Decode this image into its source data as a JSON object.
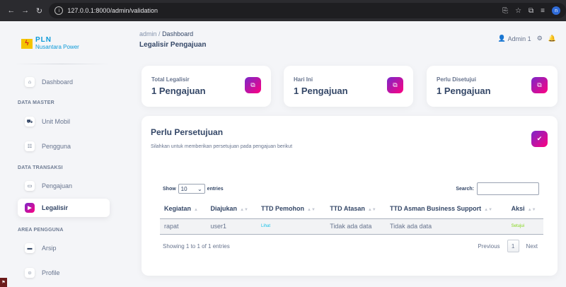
{
  "browser": {
    "url": "127.0.0.1:8000/admin/validation",
    "profile_initial": "n"
  },
  "sidebar": {
    "logo_title": "PLN",
    "logo_subtitle": "Nusantara Power",
    "items": [
      {
        "label": "Dashboard",
        "icon": "home-icon"
      },
      {
        "label": "Unit Mobil",
        "icon": "car-icon"
      },
      {
        "label": "Pengguna",
        "icon": "users-icon"
      },
      {
        "label": "Pengajuan",
        "icon": "document-icon"
      },
      {
        "label": "Legalisir",
        "icon": "stamp-icon",
        "active": true
      },
      {
        "label": "Arsip",
        "icon": "folder-icon"
      },
      {
        "label": "Profile",
        "icon": "profile-icon"
      }
    ],
    "sections": [
      "DATA MASTER",
      "DATA TRANSAKSI",
      "AREA PENGGUNA"
    ]
  },
  "header": {
    "breadcrumb_root": "admin",
    "breadcrumb_sep": "/",
    "breadcrumb_current": "Dashboard",
    "title": "Legalisir Pengajuan",
    "user_name": "Admin 1"
  },
  "stats": [
    {
      "label": "Total Legalisir",
      "value": "1 Pengajuan"
    },
    {
      "label": "Hari Ini",
      "value": "1 Pengajuan"
    },
    {
      "label": "Perlu Disetujui",
      "value": "1 Pengajuan"
    }
  ],
  "approval": {
    "title": "Perlu Persetujuan",
    "subtitle": "Silahkan untuk memberikan persetujuan pada pengajuan berikut",
    "show_label": "Show",
    "show_value": "10",
    "entries_label": "entries",
    "search_label": "Search:",
    "columns": [
      "Kegiatan",
      "Diajukan",
      "TTD Pemohon",
      "TTD Atasan",
      "TTD Asman Business Support",
      "Aksi"
    ],
    "rows": [
      [
        "rapat",
        "user1",
        "Lihat",
        "Tidak ada data",
        "Tidak ada data",
        "Setujui"
      ]
    ],
    "info": "Showing 1 to 1 of 1 entries",
    "prev_label": "Previous",
    "page": "1",
    "next_label": "Next"
  },
  "colors": {
    "accent_gradient_start": "#7928ca",
    "accent_gradient_end": "#ff0080",
    "link": "#17c1e8",
    "success": "#82d616"
  }
}
